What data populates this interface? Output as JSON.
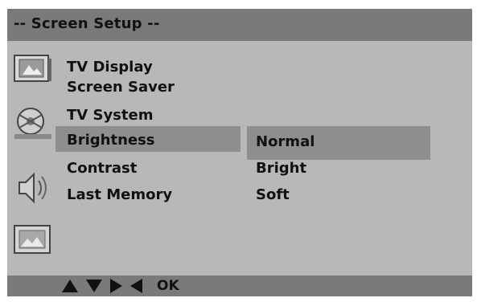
{
  "header": {
    "title": "-- Screen  Setup --"
  },
  "menu": {
    "items": [
      {
        "label": "TV Display"
      },
      {
        "label": "Screen Saver"
      },
      {
        "label": "TV System"
      },
      {
        "label": "Brightness",
        "selected": true
      },
      {
        "label": "Contrast"
      },
      {
        "label": "Last Memory"
      }
    ]
  },
  "options": {
    "items": [
      {
        "label": "Normal",
        "selected": true
      },
      {
        "label": "Bright"
      },
      {
        "label": "Soft"
      }
    ]
  },
  "icons": [
    "display-setup-icon",
    "video-reel-icon",
    "audio-speaker-icon",
    "picture-setup-icon"
  ],
  "footer": {
    "nav_hint": "OK"
  },
  "colors": {
    "panel": "#b8b8b8",
    "bar": "#7a7a7a",
    "highlight": "#8e8e8e",
    "text": "#111111"
  }
}
